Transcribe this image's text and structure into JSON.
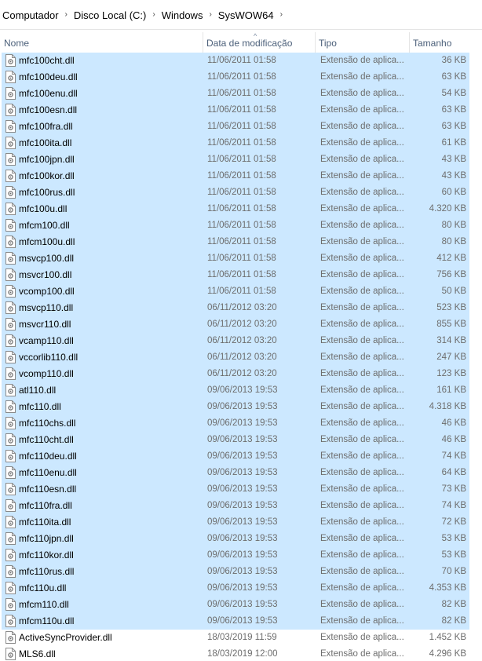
{
  "breadcrumb": [
    "Computador",
    "Disco Local (C:)",
    "Windows",
    "SysWOW64"
  ],
  "columns": {
    "name": "Nome",
    "date": "Data de modificação",
    "type": "Tipo",
    "size": "Tamanho"
  },
  "files": [
    {
      "name": "mfc100cht.dll",
      "date": "11/06/2011 01:58",
      "type": "Extensão de aplica...",
      "size": "36 KB",
      "selected": true
    },
    {
      "name": "mfc100deu.dll",
      "date": "11/06/2011 01:58",
      "type": "Extensão de aplica...",
      "size": "63 KB",
      "selected": true
    },
    {
      "name": "mfc100enu.dll",
      "date": "11/06/2011 01:58",
      "type": "Extensão de aplica...",
      "size": "54 KB",
      "selected": true
    },
    {
      "name": "mfc100esn.dll",
      "date": "11/06/2011 01:58",
      "type": "Extensão de aplica...",
      "size": "63 KB",
      "selected": true
    },
    {
      "name": "mfc100fra.dll",
      "date": "11/06/2011 01:58",
      "type": "Extensão de aplica...",
      "size": "63 KB",
      "selected": true
    },
    {
      "name": "mfc100ita.dll",
      "date": "11/06/2011 01:58",
      "type": "Extensão de aplica...",
      "size": "61 KB",
      "selected": true
    },
    {
      "name": "mfc100jpn.dll",
      "date": "11/06/2011 01:58",
      "type": "Extensão de aplica...",
      "size": "43 KB",
      "selected": true
    },
    {
      "name": "mfc100kor.dll",
      "date": "11/06/2011 01:58",
      "type": "Extensão de aplica...",
      "size": "43 KB",
      "selected": true
    },
    {
      "name": "mfc100rus.dll",
      "date": "11/06/2011 01:58",
      "type": "Extensão de aplica...",
      "size": "60 KB",
      "selected": true
    },
    {
      "name": "mfc100u.dll",
      "date": "11/06/2011 01:58",
      "type": "Extensão de aplica...",
      "size": "4.320 KB",
      "selected": true
    },
    {
      "name": "mfcm100.dll",
      "date": "11/06/2011 01:58",
      "type": "Extensão de aplica...",
      "size": "80 KB",
      "selected": true
    },
    {
      "name": "mfcm100u.dll",
      "date": "11/06/2011 01:58",
      "type": "Extensão de aplica...",
      "size": "80 KB",
      "selected": true
    },
    {
      "name": "msvcp100.dll",
      "date": "11/06/2011 01:58",
      "type": "Extensão de aplica...",
      "size": "412 KB",
      "selected": true
    },
    {
      "name": "msvcr100.dll",
      "date": "11/06/2011 01:58",
      "type": "Extensão de aplica...",
      "size": "756 KB",
      "selected": true
    },
    {
      "name": "vcomp100.dll",
      "date": "11/06/2011 01:58",
      "type": "Extensão de aplica...",
      "size": "50 KB",
      "selected": true
    },
    {
      "name": "msvcp110.dll",
      "date": "06/11/2012 03:20",
      "type": "Extensão de aplica...",
      "size": "523 KB",
      "selected": true
    },
    {
      "name": "msvcr110.dll",
      "date": "06/11/2012 03:20",
      "type": "Extensão de aplica...",
      "size": "855 KB",
      "selected": true
    },
    {
      "name": "vcamp110.dll",
      "date": "06/11/2012 03:20",
      "type": "Extensão de aplica...",
      "size": "314 KB",
      "selected": true
    },
    {
      "name": "vccorlib110.dll",
      "date": "06/11/2012 03:20",
      "type": "Extensão de aplica...",
      "size": "247 KB",
      "selected": true
    },
    {
      "name": "vcomp110.dll",
      "date": "06/11/2012 03:20",
      "type": "Extensão de aplica...",
      "size": "123 KB",
      "selected": true
    },
    {
      "name": "atl110.dll",
      "date": "09/06/2013 19:53",
      "type": "Extensão de aplica...",
      "size": "161 KB",
      "selected": true
    },
    {
      "name": "mfc110.dll",
      "date": "09/06/2013 19:53",
      "type": "Extensão de aplica...",
      "size": "4.318 KB",
      "selected": true
    },
    {
      "name": "mfc110chs.dll",
      "date": "09/06/2013 19:53",
      "type": "Extensão de aplica...",
      "size": "46 KB",
      "selected": true
    },
    {
      "name": "mfc110cht.dll",
      "date": "09/06/2013 19:53",
      "type": "Extensão de aplica...",
      "size": "46 KB",
      "selected": true
    },
    {
      "name": "mfc110deu.dll",
      "date": "09/06/2013 19:53",
      "type": "Extensão de aplica...",
      "size": "74 KB",
      "selected": true
    },
    {
      "name": "mfc110enu.dll",
      "date": "09/06/2013 19:53",
      "type": "Extensão de aplica...",
      "size": "64 KB",
      "selected": true
    },
    {
      "name": "mfc110esn.dll",
      "date": "09/06/2013 19:53",
      "type": "Extensão de aplica...",
      "size": "73 KB",
      "selected": true
    },
    {
      "name": "mfc110fra.dll",
      "date": "09/06/2013 19:53",
      "type": "Extensão de aplica...",
      "size": "74 KB",
      "selected": true
    },
    {
      "name": "mfc110ita.dll",
      "date": "09/06/2013 19:53",
      "type": "Extensão de aplica...",
      "size": "72 KB",
      "selected": true
    },
    {
      "name": "mfc110jpn.dll",
      "date": "09/06/2013 19:53",
      "type": "Extensão de aplica...",
      "size": "53 KB",
      "selected": true
    },
    {
      "name": "mfc110kor.dll",
      "date": "09/06/2013 19:53",
      "type": "Extensão de aplica...",
      "size": "53 KB",
      "selected": true
    },
    {
      "name": "mfc110rus.dll",
      "date": "09/06/2013 19:53",
      "type": "Extensão de aplica...",
      "size": "70 KB",
      "selected": true
    },
    {
      "name": "mfc110u.dll",
      "date": "09/06/2013 19:53",
      "type": "Extensão de aplica...",
      "size": "4.353 KB",
      "selected": true
    },
    {
      "name": "mfcm110.dll",
      "date": "09/06/2013 19:53",
      "type": "Extensão de aplica...",
      "size": "82 KB",
      "selected": true
    },
    {
      "name": "mfcm110u.dll",
      "date": "09/06/2013 19:53",
      "type": "Extensão de aplica...",
      "size": "82 KB",
      "selected": true
    },
    {
      "name": "ActiveSyncProvider.dll",
      "date": "18/03/2019 11:59",
      "type": "Extensão de aplica...",
      "size": "1.452 KB",
      "selected": false
    },
    {
      "name": "MLS6.dll",
      "date": "18/03/2019 12:00",
      "type": "Extensão de aplica...",
      "size": "4.296 KB",
      "selected": false
    }
  ],
  "icons": {
    "separator": "chevron-right-icon",
    "file": "dll-file-icon",
    "sort": "sort-ascending-icon"
  },
  "colors": {
    "selection": "#cce8ff",
    "header_text": "#4c607a",
    "meta_text": "#6d6d6d"
  }
}
